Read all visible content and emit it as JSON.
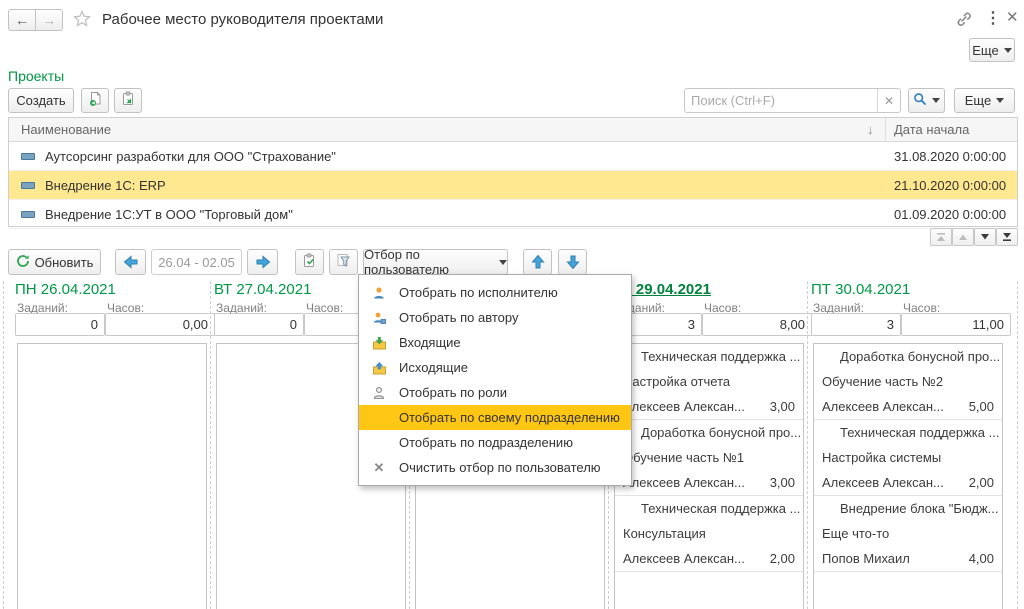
{
  "window": {
    "title": "Рабочее место руководителя проектами",
    "more_label": "Еще"
  },
  "projects": {
    "section_title": "Проекты",
    "create_label": "Создать",
    "more_label": "Еще",
    "search": {
      "placeholder": "Поиск (Ctrl+F)"
    },
    "table": {
      "columns": {
        "name": "Наименование",
        "date": "Дата начала"
      },
      "rows": [
        {
          "name": "Аутсорсинг разработки для ООО \"Страхование\"",
          "date": "31.08.2020 0:00:00",
          "selected": false
        },
        {
          "name": "Внедрение 1С: ERP",
          "date": "21.10.2020 0:00:00",
          "selected": true
        },
        {
          "name": "Внедрение 1С:УТ в ООО \"Торговый дом\"",
          "date": "01.09.2020 0:00:00",
          "selected": false
        }
      ]
    }
  },
  "calendar": {
    "refresh_label": "Обновить",
    "period": "26.04 - 02.05",
    "filter_button_label": "Отбор по пользователю",
    "labels": {
      "tasks": "Заданий:",
      "hours": "Часов:"
    },
    "days": [
      {
        "title": "ПН 26.04.2021",
        "current": false,
        "hidden": false,
        "tasks_value": "0",
        "hours_value": "0,00",
        "tasks": []
      },
      {
        "title": "ВТ 27.04.2021",
        "current": false,
        "hidden": false,
        "tasks_value": "0",
        "hours_value": "",
        "tasks": []
      },
      {
        "title": "",
        "current": false,
        "hidden": true,
        "tasks_value": "",
        "hours_value": "",
        "tasks": []
      },
      {
        "title": "ЧТ 29.04.2021",
        "current": true,
        "hidden": false,
        "tasks_value": "3",
        "hours_value": "8,00",
        "tasks": [
          {
            "project": "Техническая поддержка ...",
            "task": "Настройка отчета",
            "assignee": "Алексеев Алексан...",
            "hours": "3,00"
          },
          {
            "project": "Доработка бонусной про...",
            "task": "Обучение часть №1",
            "assignee": "Алексеев Алексан...",
            "hours": "3,00"
          },
          {
            "project": "Техническая поддержка ...",
            "task": "Консультация",
            "assignee": "Алексеев Алексан...",
            "hours": "2,00"
          }
        ]
      },
      {
        "title": "ПТ 30.04.2021",
        "current": false,
        "hidden": false,
        "tasks_value": "3",
        "hours_value": "11,00",
        "tasks": [
          {
            "project": "Доработка бонусной про...",
            "task": "Обучение часть №2",
            "assignee": "Алексеев Алексан...",
            "hours": "5,00"
          },
          {
            "project": "Техническая поддержка ...",
            "task": "Настройка системы",
            "assignee": "Алексеев Алексан...",
            "hours": "2,00"
          },
          {
            "project": "Внедрение блока \"Бюдж...",
            "task": "Еще что-то",
            "assignee": "Попов Михаил",
            "hours": "4,00"
          }
        ]
      }
    ]
  },
  "user_filter_menu": {
    "items": [
      {
        "label": "Отобрать по исполнителю",
        "icon": "executor",
        "highlighted": false
      },
      {
        "label": "Отобрать по автору",
        "icon": "author",
        "highlighted": false
      },
      {
        "label": "Входящие",
        "icon": "inbox",
        "highlighted": false
      },
      {
        "label": "Исходящие",
        "icon": "outbox",
        "highlighted": false
      },
      {
        "label": "Отобрать по роли",
        "icon": "role",
        "highlighted": false
      },
      {
        "label": "Отобрать по своему подразделению",
        "icon": "none",
        "highlighted": true
      },
      {
        "label": "Отобрать по подразделению",
        "icon": "none",
        "highlighted": false
      },
      {
        "label": "Очистить отбор по пользователю",
        "icon": "clear",
        "highlighted": false
      }
    ]
  }
}
